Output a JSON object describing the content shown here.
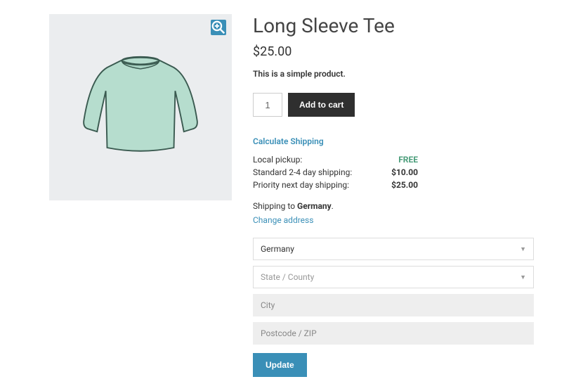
{
  "product": {
    "title": "Long Sleeve Tee",
    "price": "$25.00",
    "description": "This is a simple product.",
    "qty": "1",
    "add_to_cart": "Add to cart"
  },
  "shipping": {
    "calc_link": "Calculate Shipping",
    "rows": [
      {
        "label": "Local pickup:",
        "value": "FREE",
        "free": true
      },
      {
        "label": "Standard 2-4 day shipping:",
        "value": "$10.00",
        "free": false
      },
      {
        "label": "Priority next day shipping:",
        "value": "$25.00",
        "free": false
      }
    ],
    "to_prefix": "Shipping to ",
    "to_country": "Germany",
    "change_link": "Change address"
  },
  "address": {
    "country": "Germany",
    "state_placeholder": "State / County",
    "city_placeholder": "City",
    "zip_placeholder": "Postcode / ZIP",
    "update": "Update"
  }
}
